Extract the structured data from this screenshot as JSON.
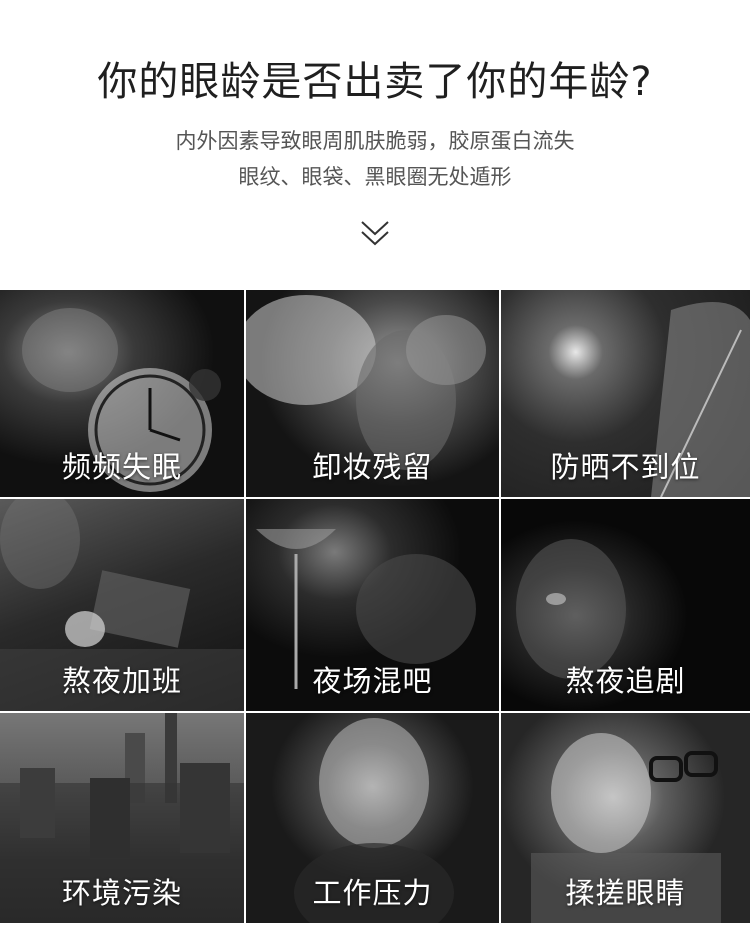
{
  "header": {
    "title": "你的眼龄是否出卖了你的年龄?",
    "subtitle_line1": "内外因素导致眼周肌肤脆弱，胶原蛋白流失",
    "subtitle_line2": "眼纹、眼袋、黑眼圈无处遁形",
    "chevron_icon": "double-chevron-down-icon"
  },
  "tiles": [
    {
      "label": "频频失眠"
    },
    {
      "label": "卸妆残留"
    },
    {
      "label": "防晒不到位"
    },
    {
      "label": "熬夜加班"
    },
    {
      "label": "夜场混吧"
    },
    {
      "label": "熬夜追剧"
    },
    {
      "label": "环境污染"
    },
    {
      "label": "工作压力"
    },
    {
      "label": "揉搓眼睛"
    }
  ],
  "colors": {
    "title": "#1f1f1f",
    "subtitle": "#555555",
    "label": "#ffffff"
  }
}
